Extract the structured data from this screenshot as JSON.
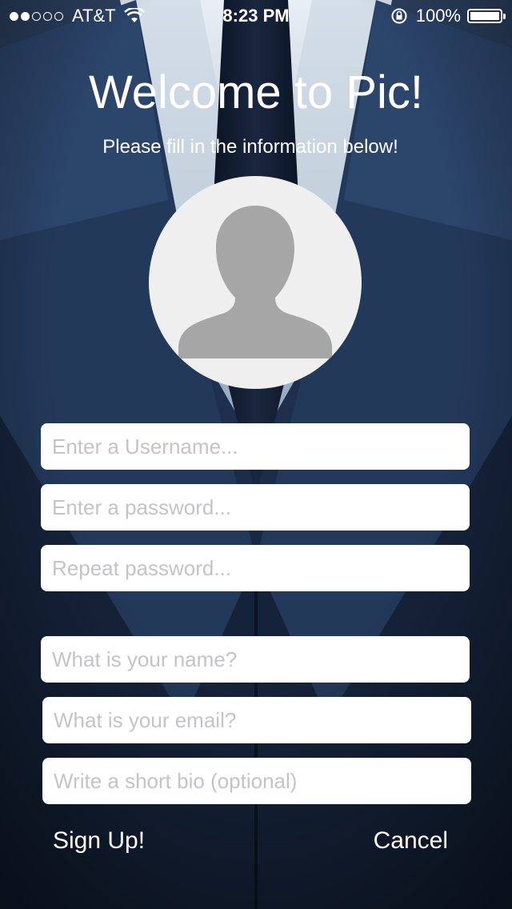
{
  "status_bar": {
    "carrier": "AT&T",
    "time": "8:23 PM",
    "battery": "100%",
    "signal_bars_filled": 2,
    "signal_bars_total": 5
  },
  "header": {
    "title": "Welcome to Pic!",
    "subtitle": "Please fill in the information below!"
  },
  "avatar": {
    "icon": "person-silhouette-icon"
  },
  "form": {
    "username_placeholder": "Enter a Username...",
    "password_placeholder": "Enter a password...",
    "repeat_password_placeholder": "Repeat password...",
    "name_placeholder": "What is your name?",
    "email_placeholder": "What is your email?",
    "bio_placeholder": "Write a short bio (optional)"
  },
  "actions": {
    "signup_label": "Sign Up!",
    "cancel_label": "Cancel"
  },
  "colors": {
    "background_dark": "#0b1628",
    "suit_blue": "#2c4468",
    "text": "#ffffff",
    "placeholder": "#c4c4c8",
    "avatar_bg": "#efefef",
    "avatar_silhouette": "#a6a6a6"
  }
}
